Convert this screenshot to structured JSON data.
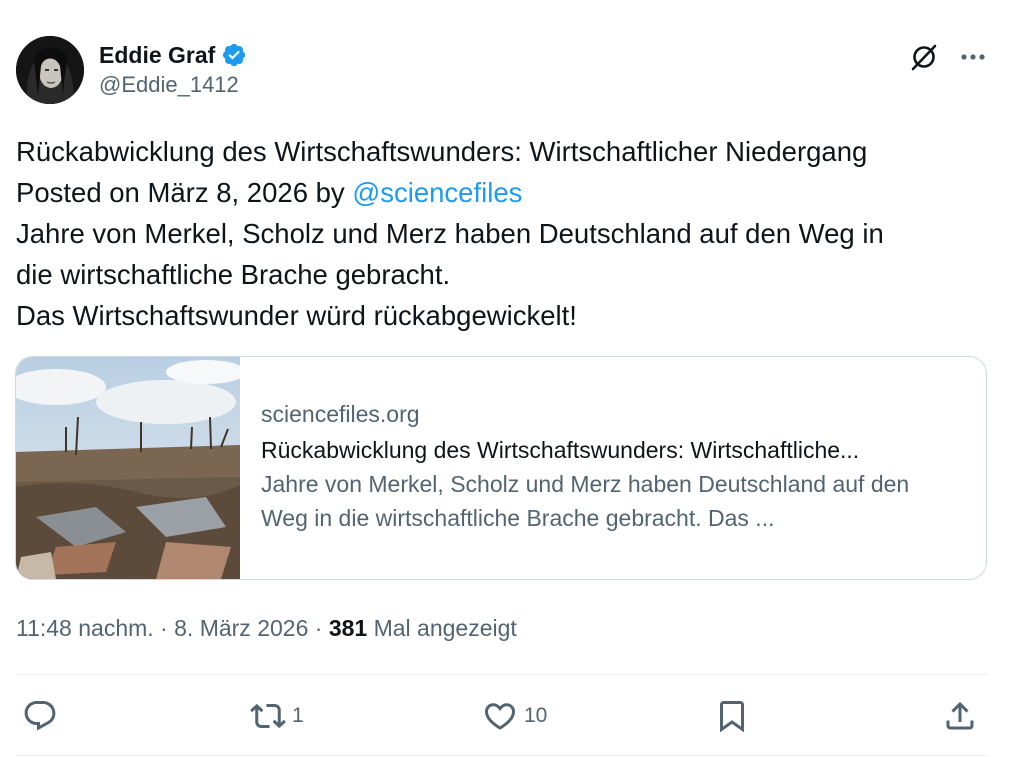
{
  "author": {
    "display_name": "Eddie Graf",
    "handle": "@Eddie_1412",
    "verified": true,
    "verified_color": "#1d9bf0"
  },
  "header_icons": [
    "grok-icon",
    "more-icon"
  ],
  "tweet": {
    "line1": "Rückabwicklung des Wirtschaftswunders: Wirtschaftlicher Niedergang",
    "line2_prefix": "Posted on März 8, 2026 by ",
    "line2_mention": "@sciencefiles",
    "line3": "Jahre von Merkel, Scholz und Merz haben Deutschland auf den Weg in",
    "line4": "die wirtschaftliche Brache gebracht.",
    "line5": "Das Wirtschaftswunder würd rückabgewickelt!"
  },
  "link_card": {
    "domain": "sciencefiles.org",
    "title": "Rückabwicklung des Wirtschaftswunders: Wirtschaftliche...",
    "description": "Jahre von Merkel, Scholz und Merz haben Deutschland auf den Weg in die wirtschaftliche Brache gebracht. Das ...",
    "image": "devastated-landscape"
  },
  "meta": {
    "time": "11:48 nachm.",
    "separator": " · ",
    "date": "8. März 2026",
    "views_count": "381",
    "views_label": " Mal angezeigt"
  },
  "actions": {
    "reply": {
      "icon": "reply-icon",
      "count": ""
    },
    "repost": {
      "icon": "repost-icon",
      "count": "1"
    },
    "like": {
      "icon": "heart-icon",
      "count": "10"
    },
    "bookmark": {
      "icon": "bookmark-icon",
      "count": ""
    },
    "share": {
      "icon": "share-icon",
      "count": ""
    }
  },
  "colors": {
    "text": "#0f1419",
    "secondary": "#536471",
    "link": "#1d9bf0",
    "border": "#cfd9de"
  }
}
